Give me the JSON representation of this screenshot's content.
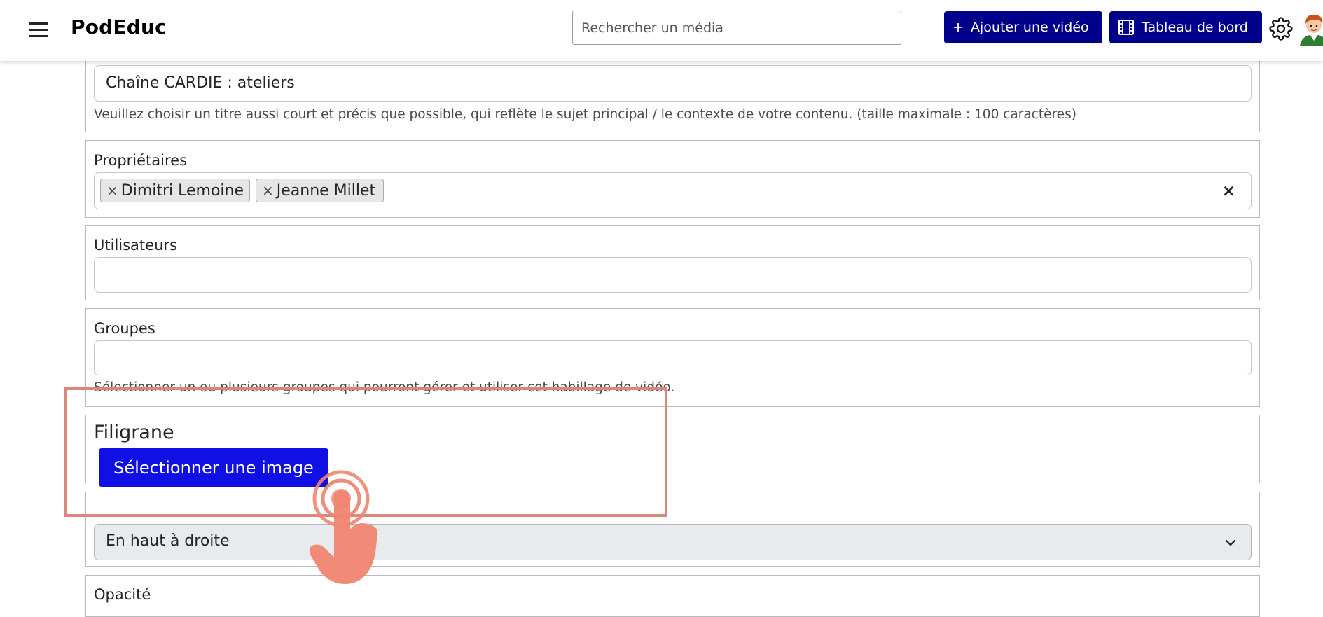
{
  "header": {
    "brand": "PodEduc",
    "search_placeholder": "Rechercher un média",
    "add_video_label": "Ajouter une vidéo",
    "dashboard_label": "Tableau de bord",
    "icons": [
      "menu-icon",
      "plus-icon",
      "film-icon",
      "gear-icon",
      "avatar"
    ]
  },
  "title_section": {
    "value": "Chaîne CARDIE : ateliers",
    "help": "Veuillez choisir un titre aussi court et précis que possible, qui reflète le sujet principal / le contexte de votre contenu. (taille maximale : 100 caractères)"
  },
  "owners": {
    "label": "Propriétaires",
    "chips": [
      "Dimitri Lemoine",
      "Jeanne Millet"
    ],
    "chip_remove": "×",
    "clear_all": "×"
  },
  "users": {
    "label": "Utilisateurs",
    "value": ""
  },
  "groups": {
    "label": "Groupes",
    "value": "",
    "help": "Sélectionner un ou plusieurs groupes qui pourront gérer et utiliser cet habillage de vidéo."
  },
  "watermark": {
    "label": "Filigrane",
    "button_label": "Sélectionner une image"
  },
  "position": {
    "selected": "En haut à droite"
  },
  "opacity": {
    "label": "Opacité"
  },
  "colors": {
    "brand_navy": "#00008b",
    "primary_blue": "#0f0fe6",
    "highlight": "#d9877a",
    "pointer_hand": "#f08672"
  }
}
